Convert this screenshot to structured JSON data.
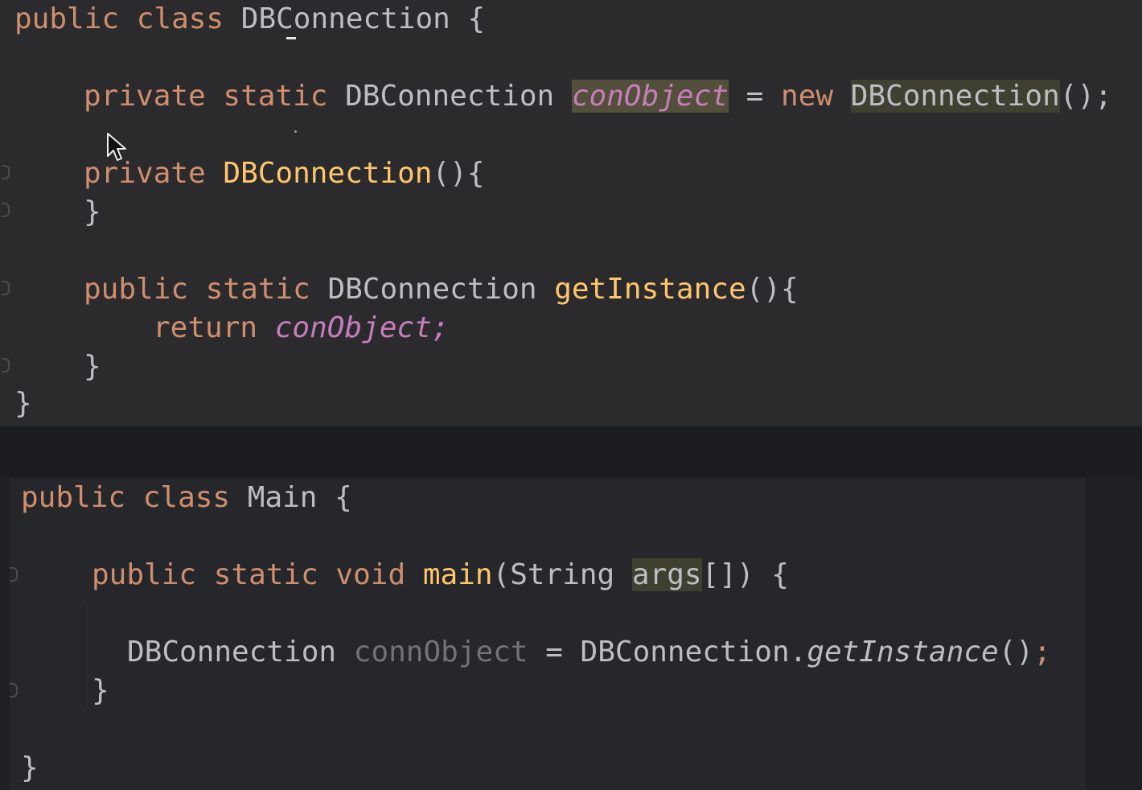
{
  "editor": {
    "top_file": {
      "line1": {
        "kw": "public class ",
        "name": "DBConnection",
        "brace": " {"
      },
      "line2": {
        "kw1": "private static ",
        "type": "DBConnection ",
        "field": "conObject",
        "eq": " = ",
        "kw2": "new ",
        "ctor": "DBConnection",
        "tail": "();"
      },
      "line3": {
        "kw": "private ",
        "ctor": "DBConnection",
        "tail": "(){"
      },
      "line4": "}",
      "line5": {
        "kw": "public static ",
        "type": "DBConnection ",
        "fn": "getInstance",
        "tail": "(){"
      },
      "line6": {
        "kw": "return ",
        "field": "conObject",
        "tail": ";"
      },
      "line7": "}",
      "line8": "}"
    },
    "bottom_file": {
      "line1": {
        "kw": "public class ",
        "name": "Main",
        "brace": " {"
      },
      "line2": {
        "kw": "public static void ",
        "fn": "main",
        "open": "(String ",
        "param": "args",
        "tail": "[]) {"
      },
      "line3": {
        "type": "DBConnection ",
        "var": "connObject",
        "eq": " = ",
        "cls": "DBConnection.",
        "call": "getInstance",
        "paren": "()",
        "semi": ";"
      },
      "line4": "}",
      "line5": "}"
    }
  },
  "colors": {
    "keyword": "#cf8e6d",
    "function": "#ffc66d",
    "field": "#c77dbb",
    "text": "#bcbec4",
    "unused": "#6f737a",
    "background": "#2b2b2d"
  },
  "icons": {
    "mouse": "mouse-pointer-icon",
    "fold": "fold-marker-icon"
  }
}
